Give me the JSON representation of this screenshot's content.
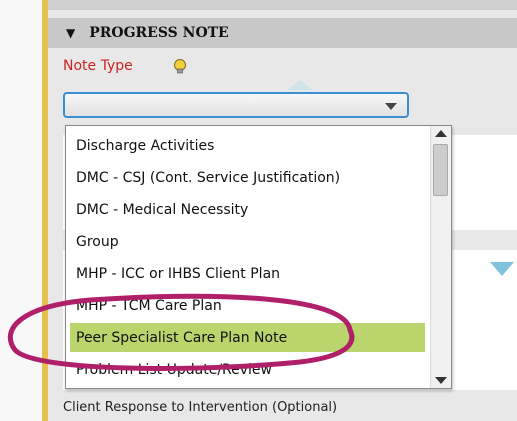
{
  "section": {
    "title": "PROGRESS NOTE",
    "toggle_glyph": "▼"
  },
  "note_type": {
    "label": "Note Type",
    "hint_icon": "lightbulb-icon",
    "selected_value": "",
    "caret_icon": "chevron-down-icon"
  },
  "dropdown": {
    "options": [
      {
        "label": "Discharge Activities"
      },
      {
        "label": "DMC - CSJ (Cont. Service Justification)"
      },
      {
        "label": "DMC - Medical Necessity"
      },
      {
        "label": "Group"
      },
      {
        "label": "MHP - ICC or IHBS Client Plan"
      },
      {
        "label": "MHP - TCM Care Plan"
      },
      {
        "label": "Peer Specialist Care Plan Note",
        "selected": true
      },
      {
        "label": "Problem List Update/Review"
      }
    ],
    "highlight_color": "#b9d56c"
  },
  "background": {
    "field_label": "Client Response to Intervention (Optional)"
  },
  "annotation": {
    "color": "#b0206a",
    "shape": "ellipse"
  }
}
